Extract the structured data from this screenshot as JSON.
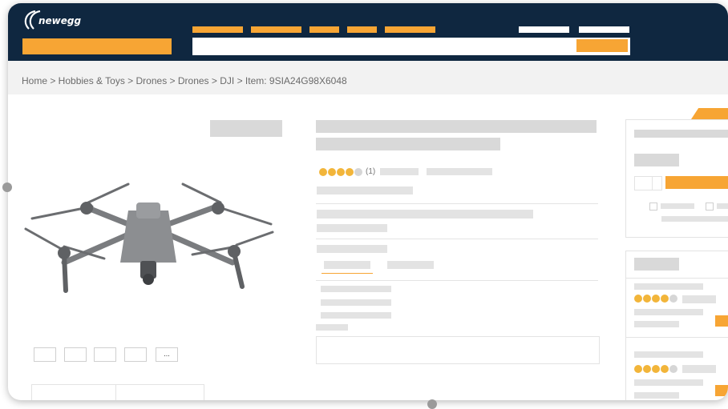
{
  "logo": {
    "text": "newegg",
    "icon": "newegg-logo-icon"
  },
  "breadcrumb": {
    "text": "Home > Hobbies & Toys > Drones >  Drones > DJI > Item: 9SIA24G98X6048"
  },
  "product": {
    "rating_count": "(1)",
    "image_icon": "drone-icon",
    "more_thumbnails": "..."
  },
  "colors": {
    "header_bg": "#0f2740",
    "accent": "#f7a534",
    "placeholder": "#d9d9d9",
    "rating_egg": "#f2b53a"
  }
}
